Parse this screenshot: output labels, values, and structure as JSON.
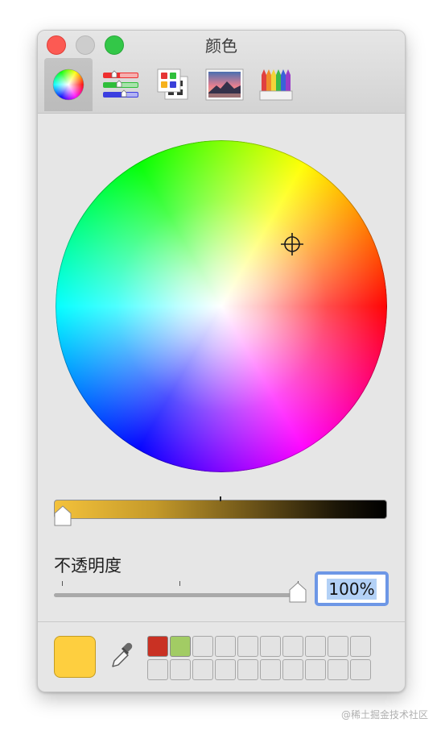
{
  "window": {
    "title": "颜色"
  },
  "toolbar": {
    "tools": [
      {
        "id": "color-wheel",
        "active": true
      },
      {
        "id": "color-sliders",
        "active": false
      },
      {
        "id": "color-palettes",
        "active": false
      },
      {
        "id": "image-palettes",
        "active": false
      },
      {
        "id": "pencils",
        "active": false
      }
    ]
  },
  "brightness": {
    "value": 1.0
  },
  "opacity": {
    "label": "不透明度",
    "value_text": "100%",
    "value": 1.0
  },
  "current_color": "#fecf3f",
  "swatches": {
    "row1": [
      "#c93123",
      "#a2cc64",
      "",
      "",
      "",
      "",
      "",
      "",
      "",
      ""
    ],
    "row2": [
      "",
      "",
      "",
      "",
      "",
      "",
      "",
      "",
      "",
      ""
    ]
  },
  "colors": {
    "close": "#fc5a53",
    "minimize": "#cdcdcd",
    "maximize": "#33c748",
    "selection": "#6d97e6"
  },
  "watermark": "@稀土掘金技术社区"
}
